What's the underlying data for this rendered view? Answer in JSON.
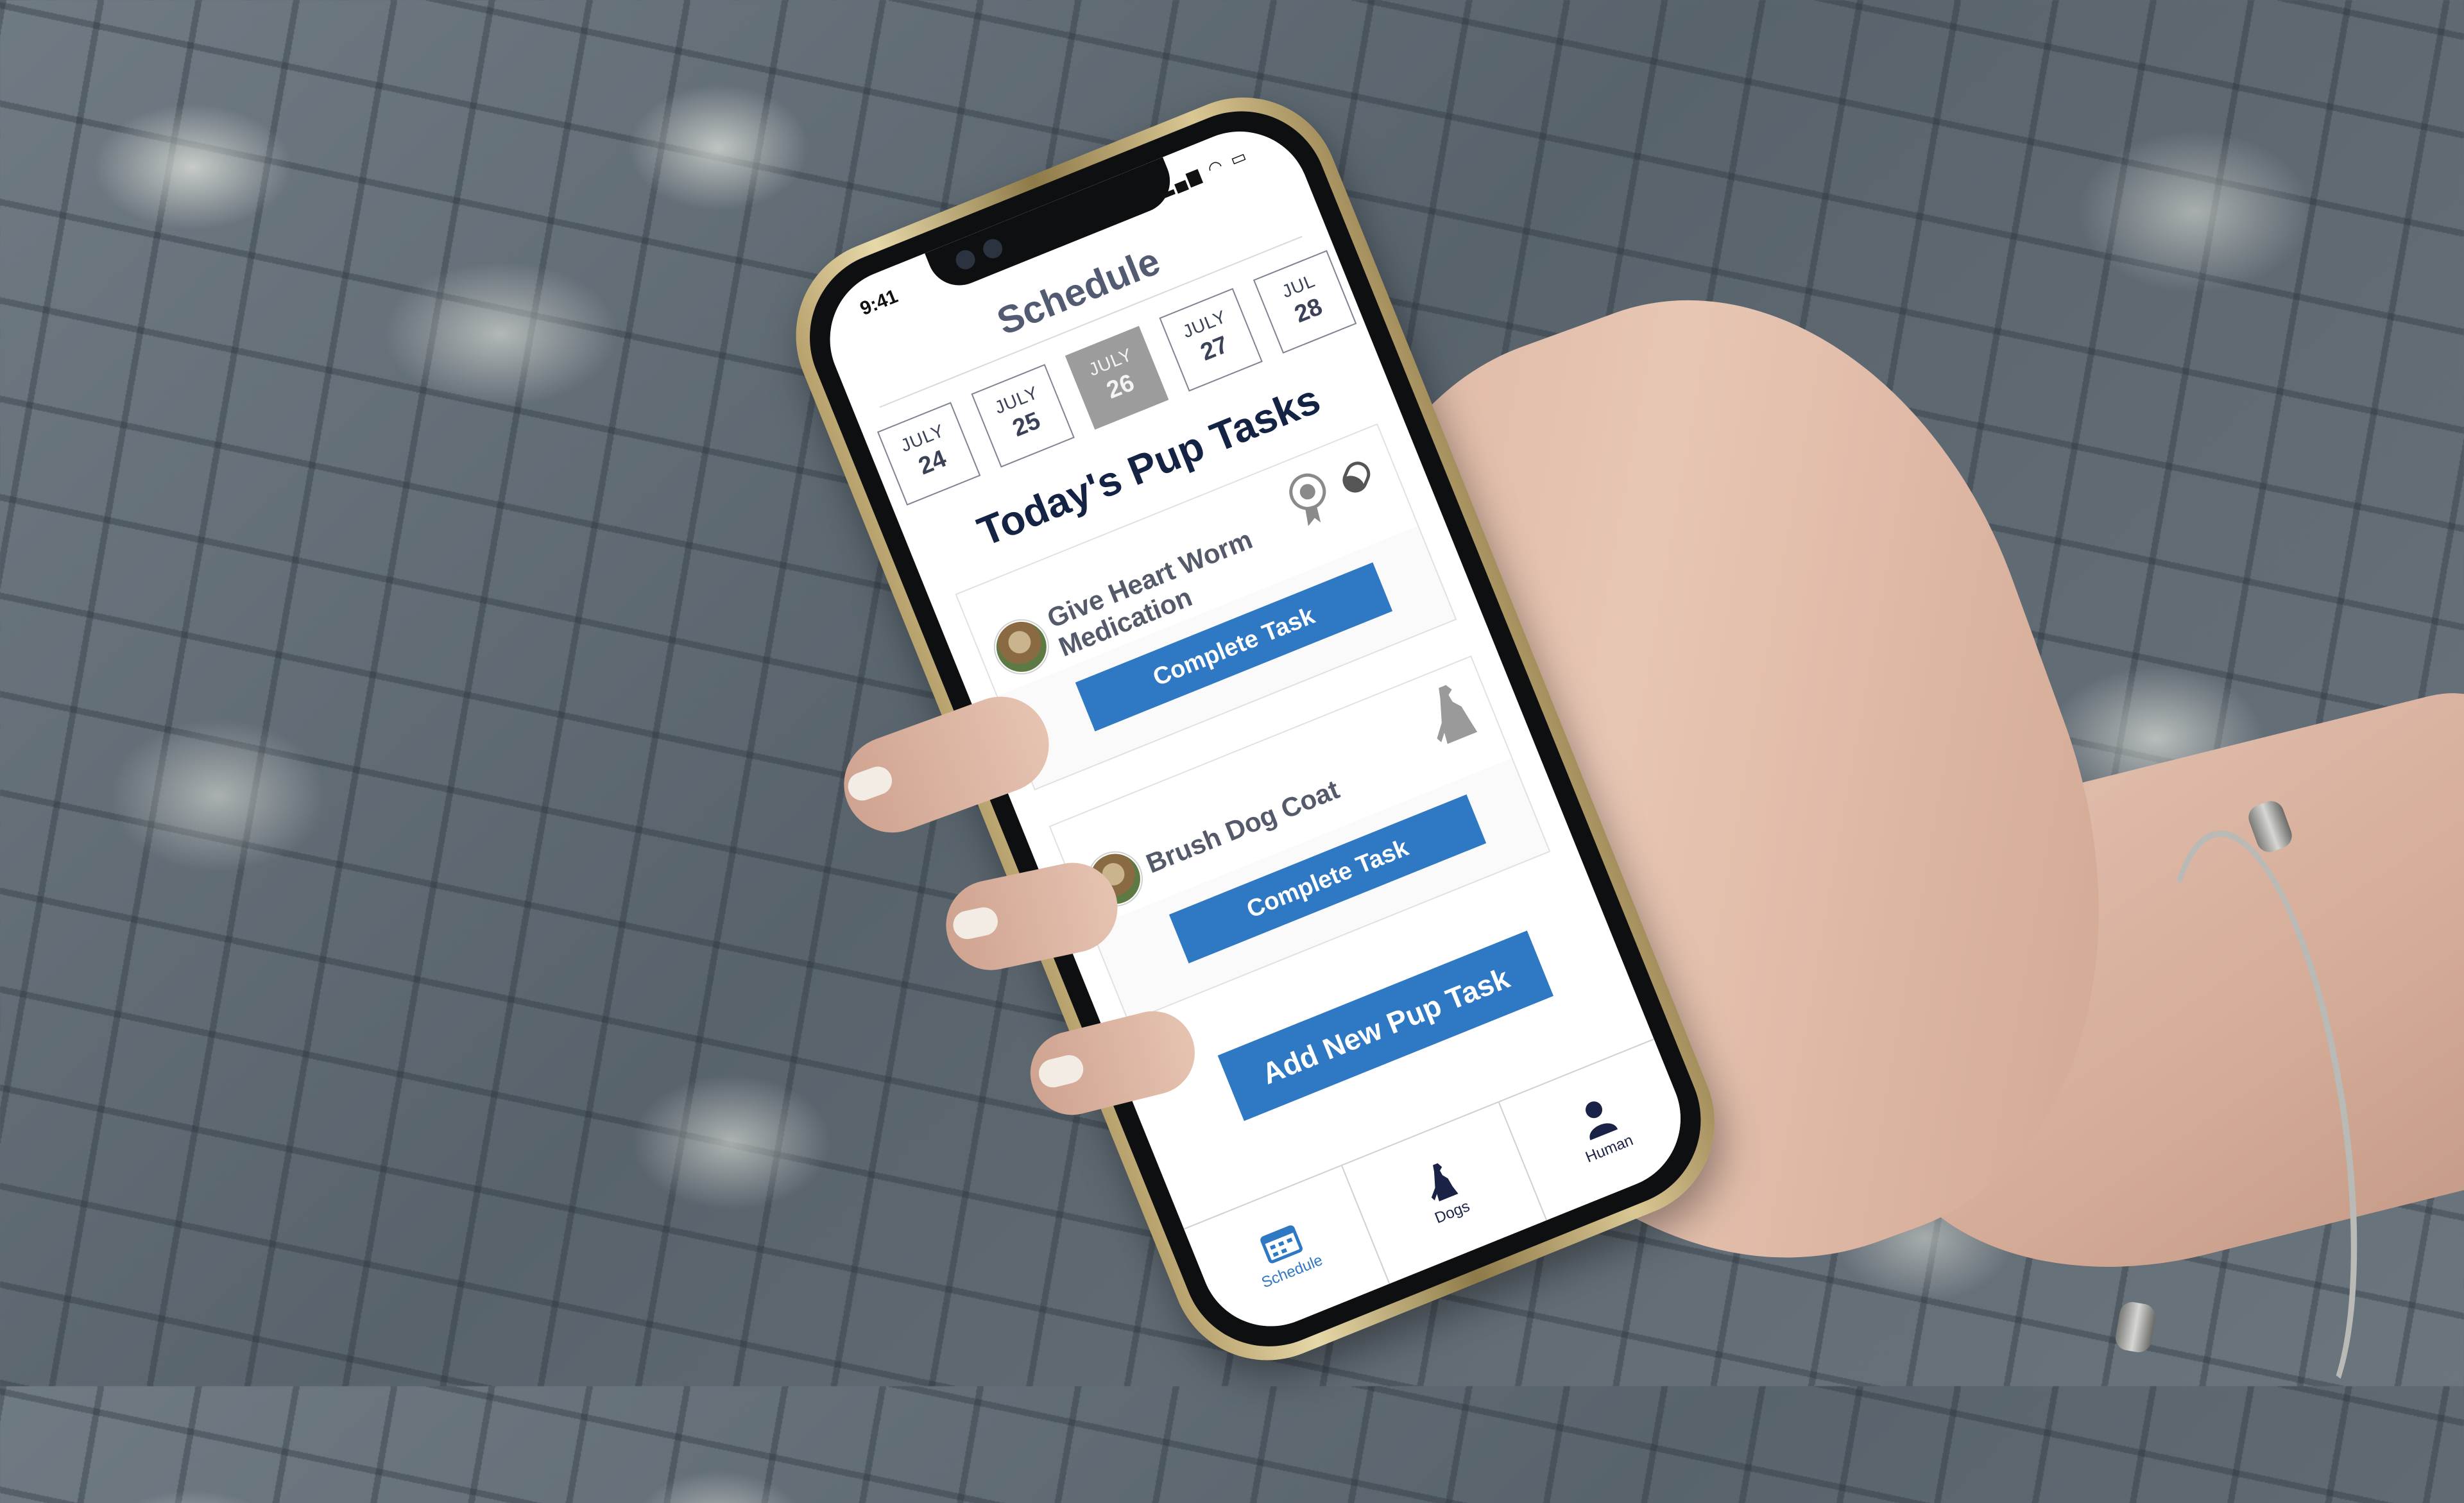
{
  "status": {
    "time": "9:41"
  },
  "header": {
    "title": "Schedule"
  },
  "dates": [
    {
      "month": "JULY",
      "day": "24",
      "selected": false
    },
    {
      "month": "JULY",
      "day": "25",
      "selected": false
    },
    {
      "month": "JULY",
      "day": "26",
      "selected": true
    },
    {
      "month": "JULY",
      "day": "27",
      "selected": false
    },
    {
      "month": "JUL",
      "day": "28",
      "selected": false
    }
  ],
  "tasks_heading": "Today's Pup Tasks",
  "tasks": [
    {
      "name_line1": "Give Heart Worm",
      "name_line2": "Medication",
      "button": "Complete Task",
      "icons": [
        "award-ribbon-icon",
        "pill-icon"
      ]
    },
    {
      "name_line1": "Brush Dog Coat",
      "name_line2": "",
      "button": "Complete Task",
      "icons": [
        "sitting-dog-icon"
      ]
    }
  ],
  "add_task_label": "Add New Pup Task",
  "tabs": [
    {
      "label": "Schedule",
      "icon": "calendar-icon",
      "active": true
    },
    {
      "label": "Dogs",
      "icon": "dog-icon",
      "active": false
    },
    {
      "label": "Human",
      "icon": "person-icon",
      "active": false
    }
  ],
  "colors": {
    "accent": "#2f78c4",
    "heading": "#142243",
    "title": "#535b72",
    "selected_date": "#9c9c9c"
  }
}
